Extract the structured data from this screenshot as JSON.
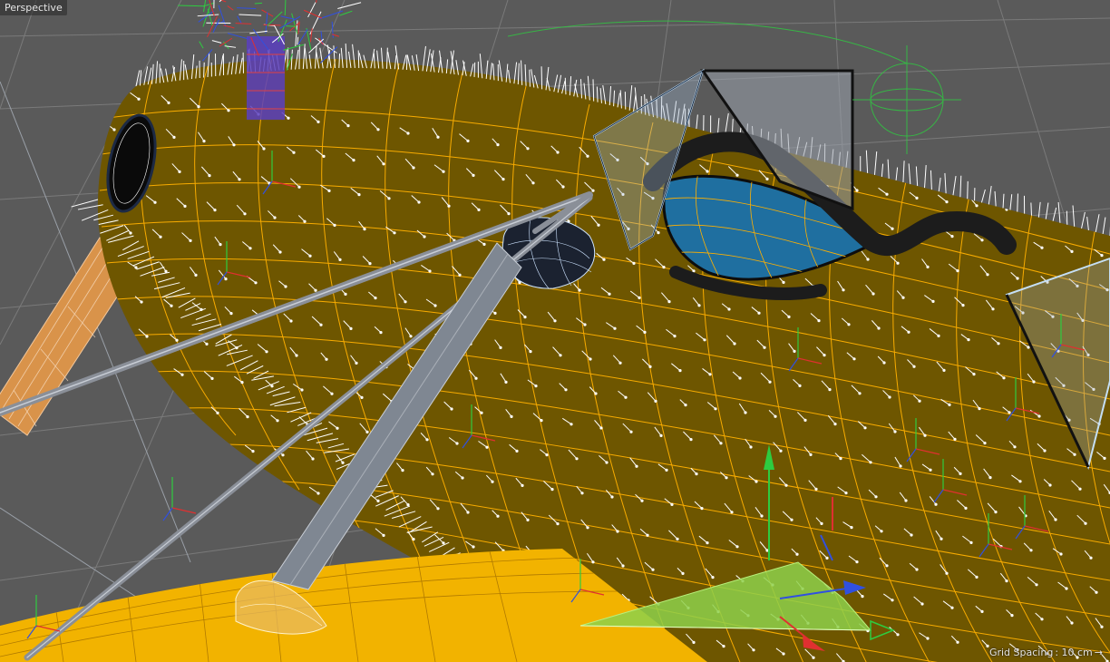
{
  "viewport": {
    "camera_label": "Perspective",
    "grid_spacing_label": "Grid Spacing",
    "grid_spacing_value": ": 10 cm",
    "grid_arrow": "→"
  },
  "colors": {
    "background": "#5a5a5a",
    "grid_line": "#7a7a7a",
    "fuselage_fill": "#6e5600",
    "wireframe_orange": "#ffb000",
    "wing_yellow": "#f2b300",
    "normal_lines": "#ffffff",
    "cockpit_glass": "#1f6fa0",
    "strut_gray": "#8a8f98",
    "axis_x": "#e03030",
    "axis_y": "#2ecc40",
    "axis_z": "#3050e0",
    "selection_plane": "#8ed04a"
  },
  "icons": [
    "move-gizmo-icon",
    "axis-arrow-x-icon",
    "axis-arrow-y-icon",
    "axis-arrow-z-icon",
    "null-object-icon"
  ]
}
